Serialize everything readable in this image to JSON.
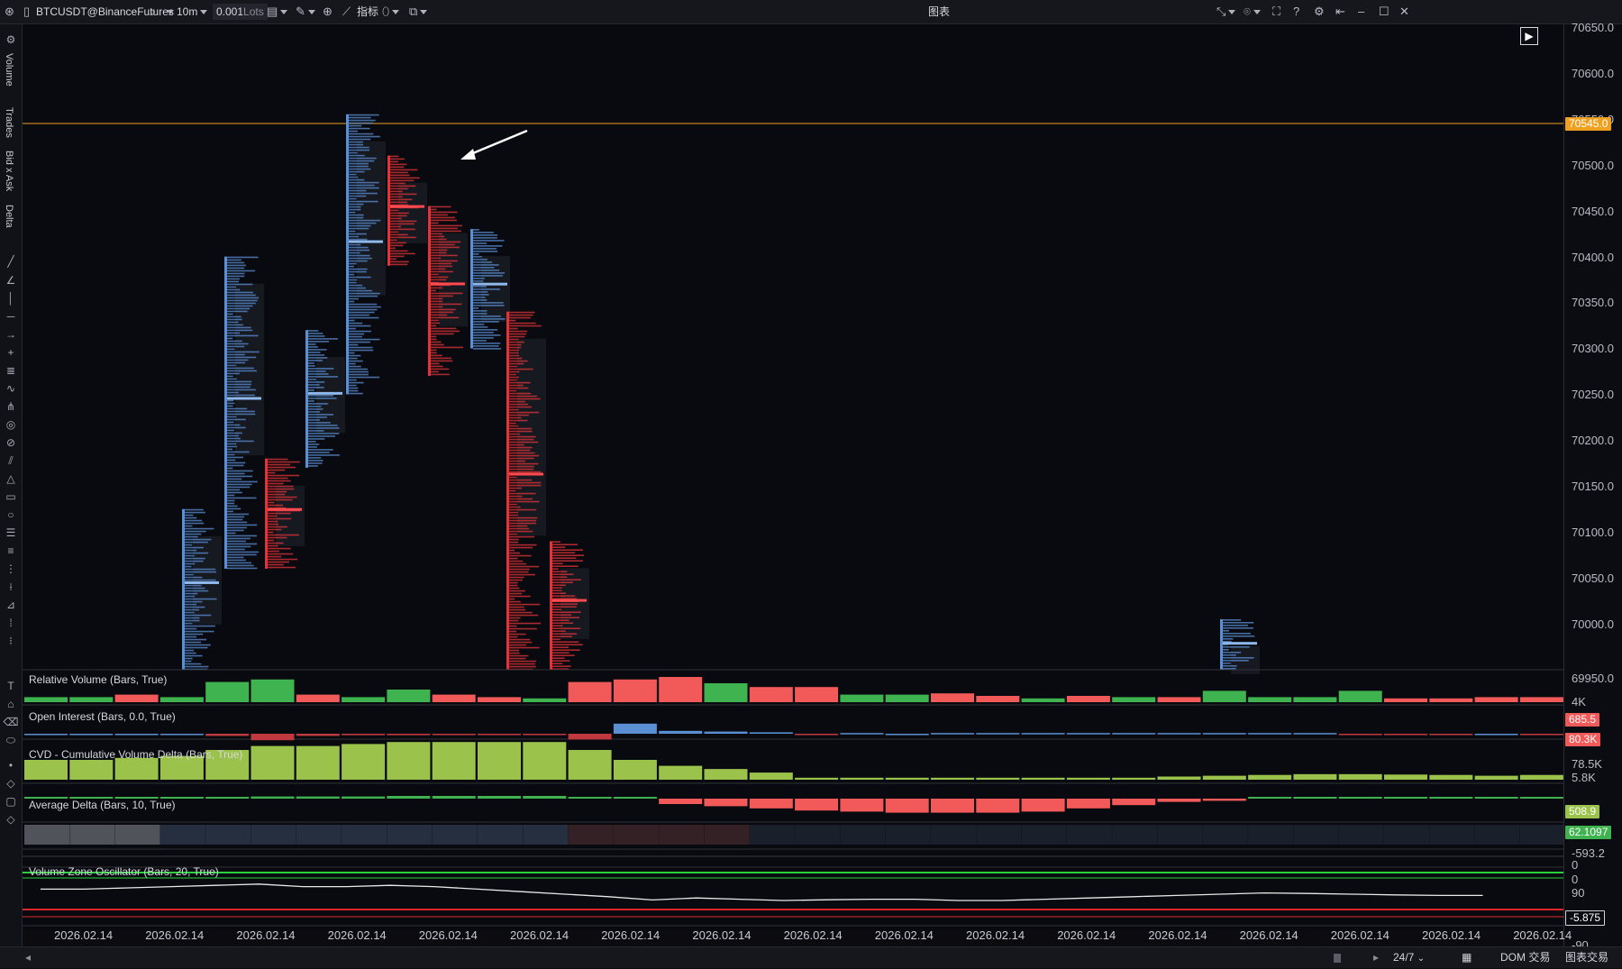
{
  "topbar": {
    "symbol": "BTCUSDT@BinanceFutures",
    "timeframe": "10m",
    "lots_value": "0.001",
    "lots_unit": "Lots",
    "indicators_label": "指标",
    "window_title": "图表",
    "icons": [
      "app-logo-icon",
      "search-icon",
      "chart-type-icon",
      "draw-icon",
      "zoom-icon",
      "indicator-icon",
      "template-icon",
      "layout-icon",
      "camera-icon",
      "fullscreen-icon",
      "help-icon",
      "settings-icon",
      "pin-icon",
      "minimize-icon",
      "maximize-icon",
      "close-icon"
    ]
  },
  "left_toolbar": {
    "vertical_labels": [
      "Volume",
      "Trades",
      "Bid x Ask",
      "Delta"
    ],
    "tools": [
      "settings-icon",
      "line-icon",
      "trend-icon",
      "horizontal-line-icon",
      "arrow-icon",
      "crosshair-icon",
      "fib-icon",
      "curve-icon",
      "pitchfork-icon",
      "circle-target-icon",
      "ruler-icon",
      "channel-icon",
      "triangle-icon",
      "rectangle-icon",
      "ellipse-icon",
      "volume-profile-icon",
      "list-icon",
      "text-icon",
      "tag-icon",
      "eraser-icon",
      "magnet-icon",
      "lock-icon",
      "eye-icon",
      "trash-icon"
    ]
  },
  "price_axis": {
    "ticks": [
      "70650.0",
      "70600.0",
      "70550.0",
      "70500.0",
      "70450.0",
      "70400.0",
      "70350.0",
      "70300.0",
      "70250.0",
      "70200.0",
      "70150.0",
      "70100.0",
      "70050.0",
      "70000.0",
      "69950.0"
    ],
    "current_price": "70545.0",
    "current_price_color": "#f0a020",
    "chart_bottom_range_label": "69950.0"
  },
  "panels": {
    "relative_volume": {
      "label": "Relative Volume (Bars, True)",
      "axis_top": "4K",
      "value": "685.5",
      "value_color": "#f25a5a"
    },
    "open_interest": {
      "label": "Open Interest (Bars, 0.0, True)",
      "value": "80.3K",
      "axis_bottom": "78.5K",
      "value_color": "#f25a5a"
    },
    "cvd": {
      "label": "CVD - Cumulative Volume Delta (Bars, True)",
      "axis_top": "5.8K",
      "value": "508.9",
      "value_color": "#9bc24b"
    },
    "average_delta": {
      "label": "Average Delta (Bars, 10, True)",
      "value": "62.1097",
      "axis_bottom": "-593.2",
      "value_color": "#3fb34f"
    },
    "heat_strip": {
      "axis_top": "0",
      "axis_bottom": "0"
    },
    "vzo": {
      "label": "Volume Zone Oscillator (Bars, 20, True)",
      "axis_top": "90",
      "value": "-5.875",
      "axis_bottom": "-90"
    }
  },
  "x_axis": {
    "labels": [
      "2026.02.14",
      "2026.02.14",
      "2026.02.14",
      "2026.02.14",
      "2026.02.14",
      "2026.02.14",
      "2026.02.14",
      "2026.02.14",
      "2026.02.14",
      "2026.02.14",
      "2026.02.14",
      "2026.02.14",
      "2026.02.14",
      "2026.02.14",
      "2026.02.14",
      "2026.02.14",
      "2026.02.14"
    ]
  },
  "statusbar": {
    "session": "24/7",
    "dom_label": "DOM 交易",
    "chart_trade_label": "图表交易"
  },
  "colors": {
    "buy": "#5b8fd4",
    "sell": "#e0343a",
    "green": "#3fb34f",
    "red": "#f25a5a",
    "cvd": "#9bc24b",
    "price_line": "#f0a020"
  },
  "chart_data": {
    "type": "footprint",
    "price_range": [
      69950,
      70650
    ],
    "current_price": 70545,
    "candles": [
      {
        "high": 70125,
        "low": 69950,
        "side": "buy"
      },
      {
        "high": 70400,
        "low": 70060,
        "side": "buy"
      },
      {
        "high": 70180,
        "low": 70060,
        "side": "sell"
      },
      {
        "high": 70320,
        "low": 70170,
        "side": "buy"
      },
      {
        "high": 70555,
        "low": 70250,
        "side": "buy"
      },
      {
        "high": 70510,
        "low": 70390,
        "side": "sell"
      },
      {
        "high": 70455,
        "low": 70270,
        "side": "sell"
      },
      {
        "high": 70430,
        "low": 70300,
        "side": "buy"
      },
      {
        "high": 70340,
        "low": 69950,
        "side": "sell"
      },
      {
        "high": 70090,
        "low": 69950,
        "side": "sell"
      },
      {
        "high": 70005,
        "low": 69950,
        "side": "buy"
      }
    ],
    "relative_volume": [
      {
        "v": 0.2,
        "c": "green"
      },
      {
        "v": 0.2,
        "c": "green"
      },
      {
        "v": 0.3,
        "c": "red"
      },
      {
        "v": 0.2,
        "c": "green"
      },
      {
        "v": 0.8,
        "c": "green"
      },
      {
        "v": 0.9,
        "c": "green"
      },
      {
        "v": 0.3,
        "c": "red"
      },
      {
        "v": 0.2,
        "c": "green"
      },
      {
        "v": 0.5,
        "c": "green"
      },
      {
        "v": 0.3,
        "c": "red"
      },
      {
        "v": 0.2,
        "c": "red"
      },
      {
        "v": 0.15,
        "c": "green"
      },
      {
        "v": 0.8,
        "c": "red"
      },
      {
        "v": 0.9,
        "c": "red"
      },
      {
        "v": 1.0,
        "c": "red"
      },
      {
        "v": 0.75,
        "c": "green"
      },
      {
        "v": 0.6,
        "c": "red"
      },
      {
        "v": 0.6,
        "c": "red"
      },
      {
        "v": 0.3,
        "c": "green"
      },
      {
        "v": 0.3,
        "c": "green"
      },
      {
        "v": 0.35,
        "c": "red"
      },
      {
        "v": 0.25,
        "c": "red"
      },
      {
        "v": 0.15,
        "c": "green"
      },
      {
        "v": 0.25,
        "c": "red"
      },
      {
        "v": 0.2,
        "c": "green"
      },
      {
        "v": 0.2,
        "c": "red"
      },
      {
        "v": 0.45,
        "c": "green"
      },
      {
        "v": 0.2,
        "c": "green"
      },
      {
        "v": 0.2,
        "c": "green"
      },
      {
        "v": 0.45,
        "c": "green"
      },
      {
        "v": 0.15,
        "c": "red"
      },
      {
        "v": 0.15,
        "c": "red"
      },
      {
        "v": 0.2,
        "c": "red"
      },
      {
        "v": 0.2,
        "c": "red"
      }
    ],
    "open_interest_delta": [
      0,
      0,
      0,
      0,
      -0.15,
      -0.45,
      -0.15,
      -0.1,
      -0.1,
      -0.05,
      -0.05,
      -0.05,
      -0.4,
      0.7,
      0.2,
      0.15,
      0.1,
      -0.05,
      0.05,
      0,
      0.05,
      0.05,
      0.05,
      0.05,
      0.05,
      0.05,
      0.05,
      0.05,
      0.05,
      -0.05,
      -0.05,
      -0.05,
      0,
      -0.05
    ],
    "cvd": [
      0.5,
      0.5,
      0.55,
      0.6,
      0.75,
      0.85,
      0.85,
      0.9,
      0.95,
      0.95,
      0.95,
      0.95,
      0.75,
      0.5,
      0.35,
      0.27,
      0.18,
      0.05,
      0.05,
      0.05,
      0.05,
      0.05,
      0.05,
      0.05,
      0.05,
      0.08,
      0.1,
      0.12,
      0.14,
      0.14,
      0.13,
      0.12,
      0.1,
      0.12
    ],
    "average_delta": [
      0,
      0,
      0,
      0,
      0.15,
      0.2,
      0.2,
      0.2,
      0.25,
      0.25,
      0.25,
      0.25,
      0.15,
      0,
      -0.25,
      -0.35,
      -0.45,
      -0.55,
      -0.6,
      -0.65,
      -0.65,
      -0.65,
      -0.6,
      -0.45,
      -0.3,
      -0.15,
      -0.1,
      0.05,
      0.05,
      0.05,
      0.05,
      0.05,
      0.05,
      0.05
    ],
    "vzo": [
      0.45,
      0.45,
      0.5,
      0.55,
      0.6,
      0.65,
      0.55,
      0.55,
      0.6,
      0.55,
      0.45,
      0.35,
      0.25,
      0.15,
      0.02,
      0.1,
      0.05,
      0.0,
      0.03,
      0.05,
      0.05,
      0.0,
      0.0,
      0.05,
      0.1,
      0.15,
      0.2,
      0.25,
      0.3,
      0.28,
      0.25,
      0.22,
      0.2,
      0.2
    ]
  }
}
